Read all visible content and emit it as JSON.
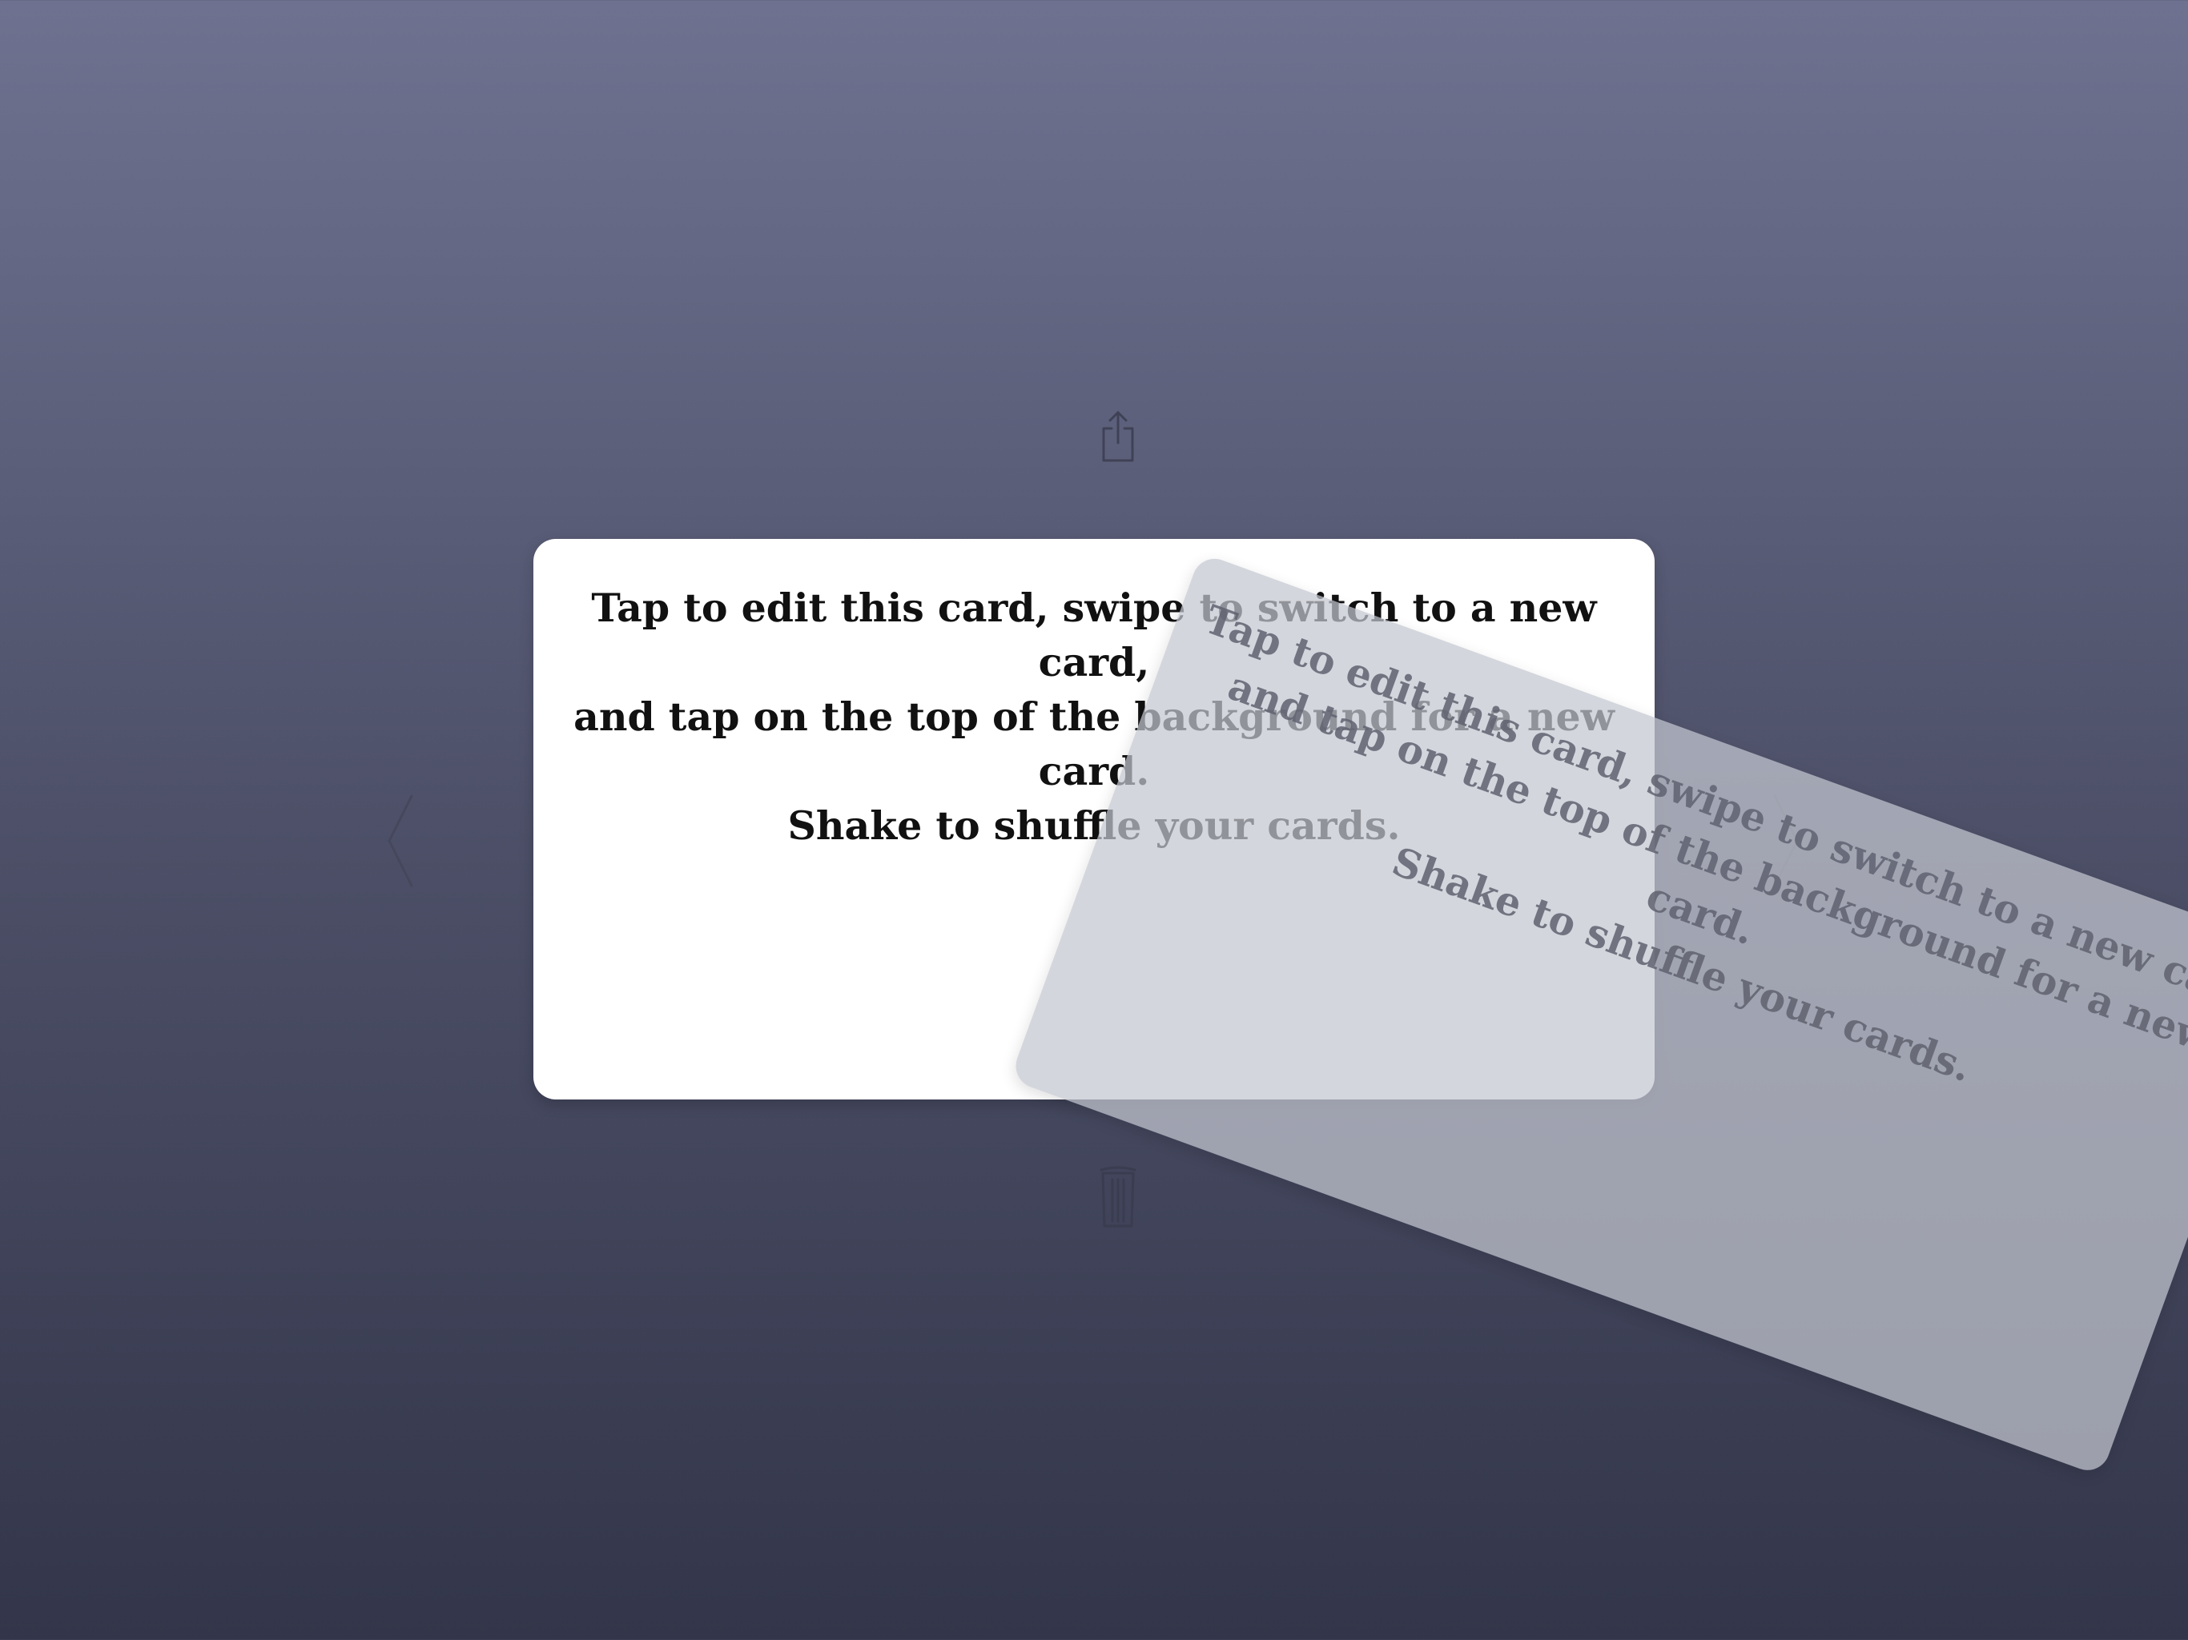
{
  "background": {
    "gradient_top": "#6e7290",
    "gradient_bottom": "#33364a"
  },
  "toolbar": {
    "share_icon": "share-icon",
    "trash_icon": "trash-icon",
    "previous_icon": "chevron-left-icon",
    "next_icon": "chevron-right-icon"
  },
  "card": {
    "text": "Tap to edit this card, swipe to switch to a new card,\nand tap on the top of the background for a new card.\nShake to shuffle your cards."
  },
  "next_card": {
    "text": "Tap to edit this card, swipe to switch to a new card,\nand tap on the top of the background for a new card.\nShake to shuffle your cards."
  }
}
